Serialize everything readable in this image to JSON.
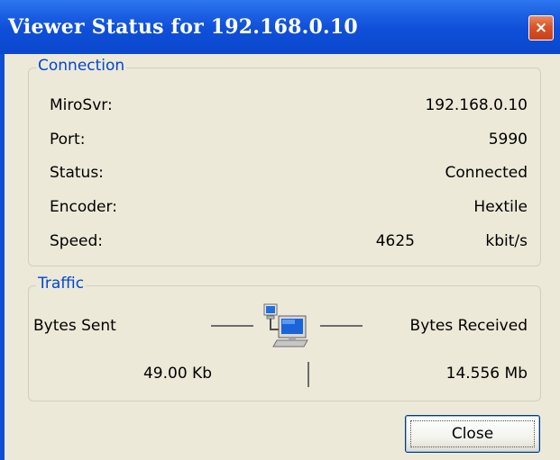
{
  "window": {
    "title": "Viewer Status for 192.168.0.10"
  },
  "connection": {
    "title": "Connection",
    "rows": [
      {
        "label": "MiroSvr:",
        "value": "192.168.0.10"
      },
      {
        "label": "Port:",
        "value": "5990"
      },
      {
        "label": "Status:",
        "value": "Connected"
      },
      {
        "label": "Encoder:",
        "value": "Hextile"
      },
      {
        "label": "Speed:",
        "value": "4625",
        "unit": "kbit/s"
      }
    ]
  },
  "traffic": {
    "title": "Traffic",
    "sent_label": "Bytes Sent",
    "received_label": "Bytes Received",
    "sent_value": "49.00 Kb",
    "received_value": "14.556 Mb"
  },
  "buttons": {
    "close_label": "Close",
    "close_glyph": "×"
  },
  "icons": {
    "title_close": "close-icon",
    "network": "network-computers-icon"
  },
  "colors": {
    "titlebar": "#0a47cd",
    "groupbox_title": "#0046d5",
    "dialog_bg": "#ece9d8",
    "close_button": "#d9552a"
  }
}
